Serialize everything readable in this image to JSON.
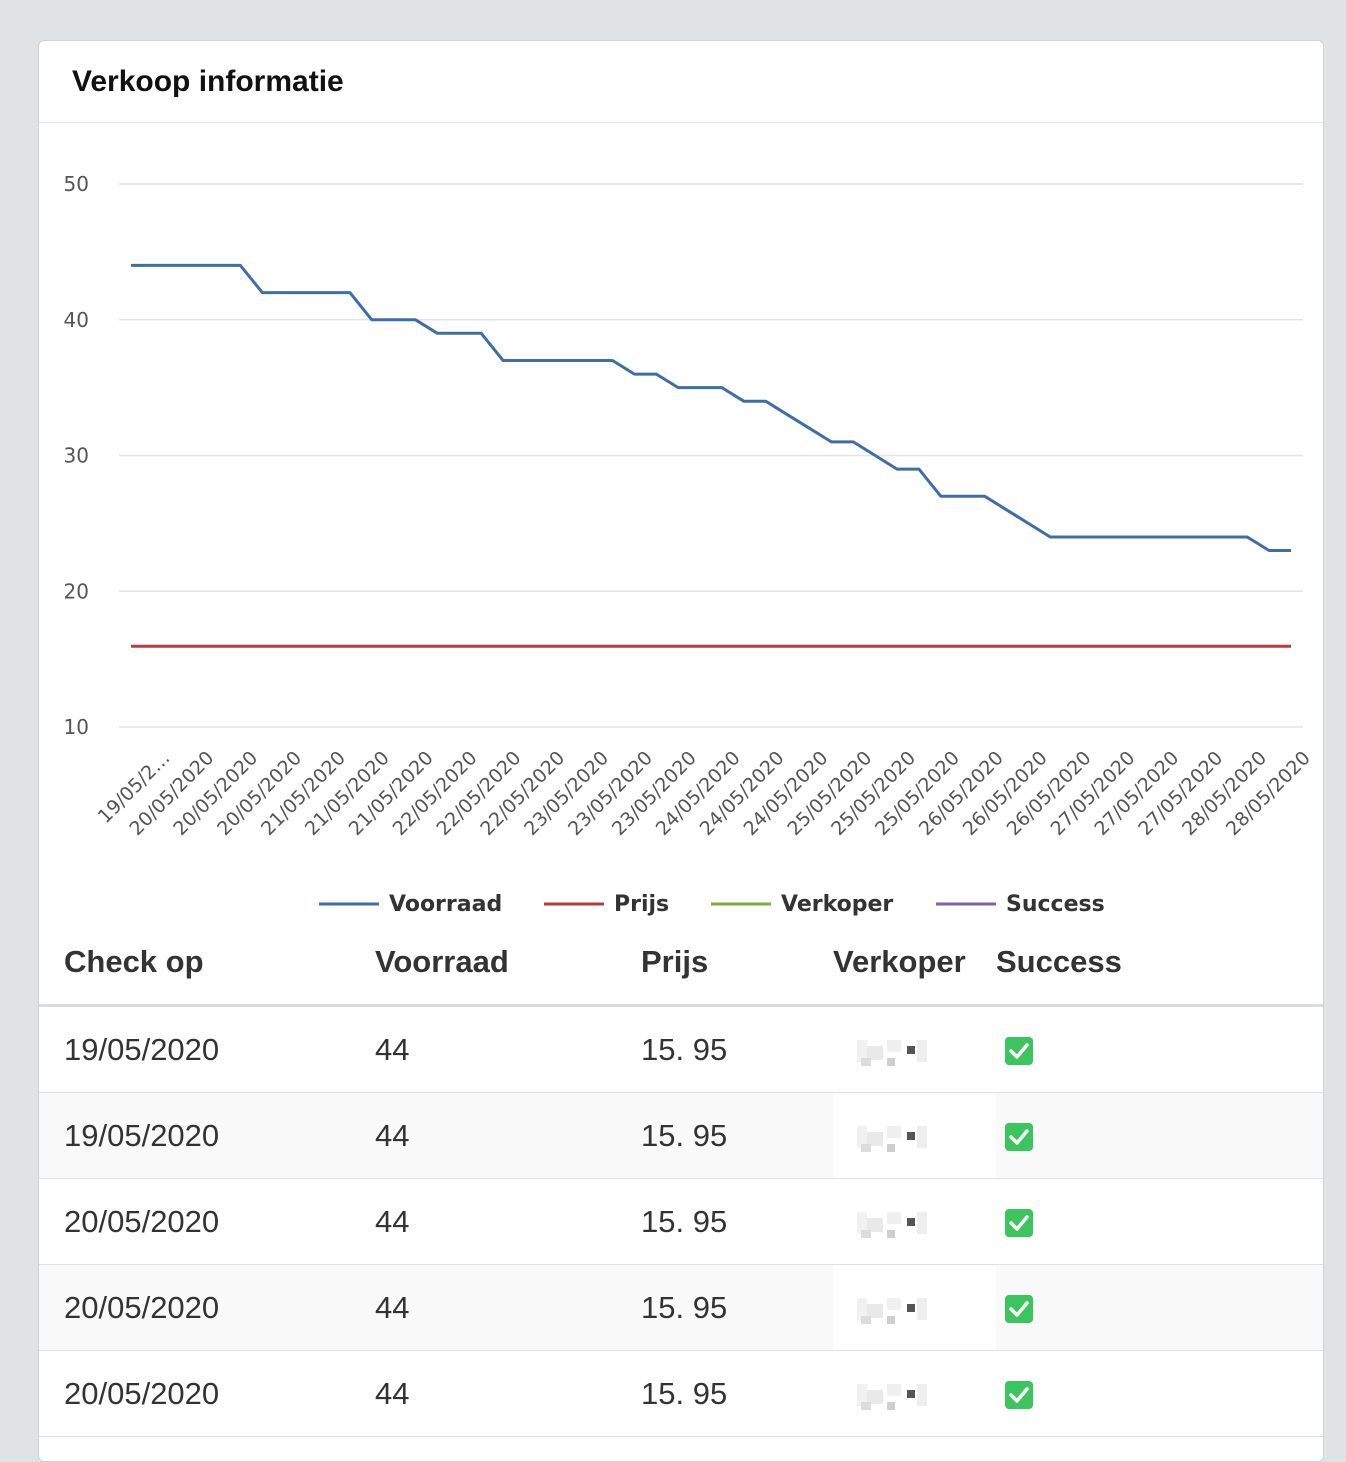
{
  "card": {
    "title": "Verkoop informatie"
  },
  "colors": {
    "voorraad": "#3f6da8",
    "prijs": "#b53d3d",
    "verkoper": "#7fab3d",
    "success": "#8062a0",
    "check": "#3cc55e"
  },
  "chart_data": {
    "type": "line",
    "title": "",
    "xlabel": "",
    "ylabel": "",
    "ylim": [
      10,
      50
    ],
    "yticks": [
      10,
      20,
      30,
      40,
      50
    ],
    "grid": true,
    "legend_position": "bottom",
    "x_tick_labels": [
      "19/05/2…",
      "20/05/2020",
      "20/05/2020",
      "20/05/2020",
      "21/05/2020",
      "21/05/2020",
      "21/05/2020",
      "22/05/2020",
      "22/05/2020",
      "22/05/2020",
      "23/05/2020",
      "23/05/2020",
      "23/05/2020",
      "24/05/2020",
      "24/05/2020",
      "24/05/2020",
      "25/05/2020",
      "25/05/2020",
      "25/05/2020",
      "26/05/2020",
      "26/05/2020",
      "26/05/2020",
      "27/05/2020",
      "27/05/2020",
      "27/05/2020",
      "28/05/2020",
      "28/05/2020"
    ],
    "series": [
      {
        "name": "Voorraad",
        "values": [
          44,
          44,
          44,
          44,
          44,
          44,
          42,
          42,
          42,
          42,
          42,
          40,
          40,
          40,
          39,
          39,
          39,
          37,
          37,
          37,
          37,
          37,
          37,
          36,
          36,
          35,
          35,
          35,
          34,
          34,
          33,
          32,
          31,
          31,
          30,
          29,
          29,
          27,
          27,
          27,
          26,
          25,
          24,
          24,
          24,
          24,
          24,
          24,
          24,
          24,
          24,
          24,
          23,
          23
        ]
      },
      {
        "name": "Prijs",
        "values": [
          15.95,
          15.95,
          15.95,
          15.95,
          15.95,
          15.95,
          15.95,
          15.95,
          15.95,
          15.95,
          15.95,
          15.95,
          15.95,
          15.95,
          15.95,
          15.95,
          15.95,
          15.95,
          15.95,
          15.95,
          15.95,
          15.95,
          15.95,
          15.95,
          15.95,
          15.95,
          15.95,
          15.95,
          15.95,
          15.95,
          15.95,
          15.95,
          15.95,
          15.95,
          15.95,
          15.95,
          15.95,
          15.95,
          15.95,
          15.95,
          15.95,
          15.95,
          15.95,
          15.95,
          15.95,
          15.95,
          15.95,
          15.95,
          15.95,
          15.95,
          15.95,
          15.95,
          15.95,
          15.95
        ]
      },
      {
        "name": "Verkoper",
        "values": []
      },
      {
        "name": "Success",
        "values": []
      }
    ]
  },
  "table": {
    "headers": {
      "date": "Check op",
      "stock": "Voorraad",
      "price": "Prijs",
      "seller": "Verkoper",
      "success": "Success"
    },
    "rows": [
      {
        "date": "19/05/2020",
        "stock": "44",
        "price": "15. 95",
        "success": true
      },
      {
        "date": "19/05/2020",
        "stock": "44",
        "price": "15. 95",
        "success": true
      },
      {
        "date": "20/05/2020",
        "stock": "44",
        "price": "15. 95",
        "success": true
      },
      {
        "date": "20/05/2020",
        "stock": "44",
        "price": "15. 95",
        "success": true
      },
      {
        "date": "20/05/2020",
        "stock": "44",
        "price": "15. 95",
        "success": true
      }
    ]
  }
}
